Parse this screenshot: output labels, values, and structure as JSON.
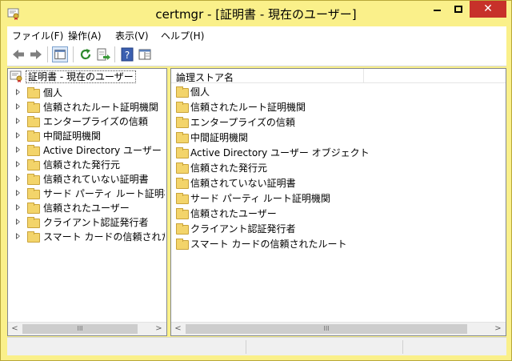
{
  "window": {
    "title": "certmgr - [証明書 - 現在のユーザー]",
    "close_glyph": "✕"
  },
  "menu": [
    "ファイル(F)",
    "操作(A)",
    "表示(V)",
    "ヘルプ(H)"
  ],
  "toolbar": {
    "icons": [
      "back-arrow-icon",
      "forward-arrow-icon",
      "show-hide-console-tree-icon",
      "refresh-icon",
      "export-list-icon",
      "help-icon",
      "properties-icon"
    ]
  },
  "tree": {
    "root_label": "証明書 - 現在のユーザー",
    "items": [
      "個人",
      "信頼されたルート証明機関",
      "エンタープライズの信頼",
      "中間証明機関",
      "Active Directory ユーザー オブジェクト",
      "信頼された発行元",
      "信頼されていない証明書",
      "サード パーティ ルート証明機関",
      "信頼されたユーザー",
      "クライアント認証発行者",
      "スマート カードの信頼されたルート"
    ]
  },
  "list": {
    "column_header": "論理ストア名",
    "items": [
      "個人",
      "信頼されたルート証明機関",
      "エンタープライズの信頼",
      "中間証明機関",
      "Active Directory ユーザー オブジェクト",
      "信頼された発行元",
      "信頼されていない証明書",
      "サード パーティ ルート証明機関",
      "信頼されたユーザー",
      "クライアント認証発行者",
      "スマート カードの信頼されたルート"
    ]
  },
  "scrollbar": {
    "left_arrow": "<",
    "right_arrow": ">",
    "thumb_grip": "III"
  },
  "colors": {
    "title_bar": "#faf08a",
    "close_button": "#c7312a",
    "folder": "#f3d46a"
  }
}
